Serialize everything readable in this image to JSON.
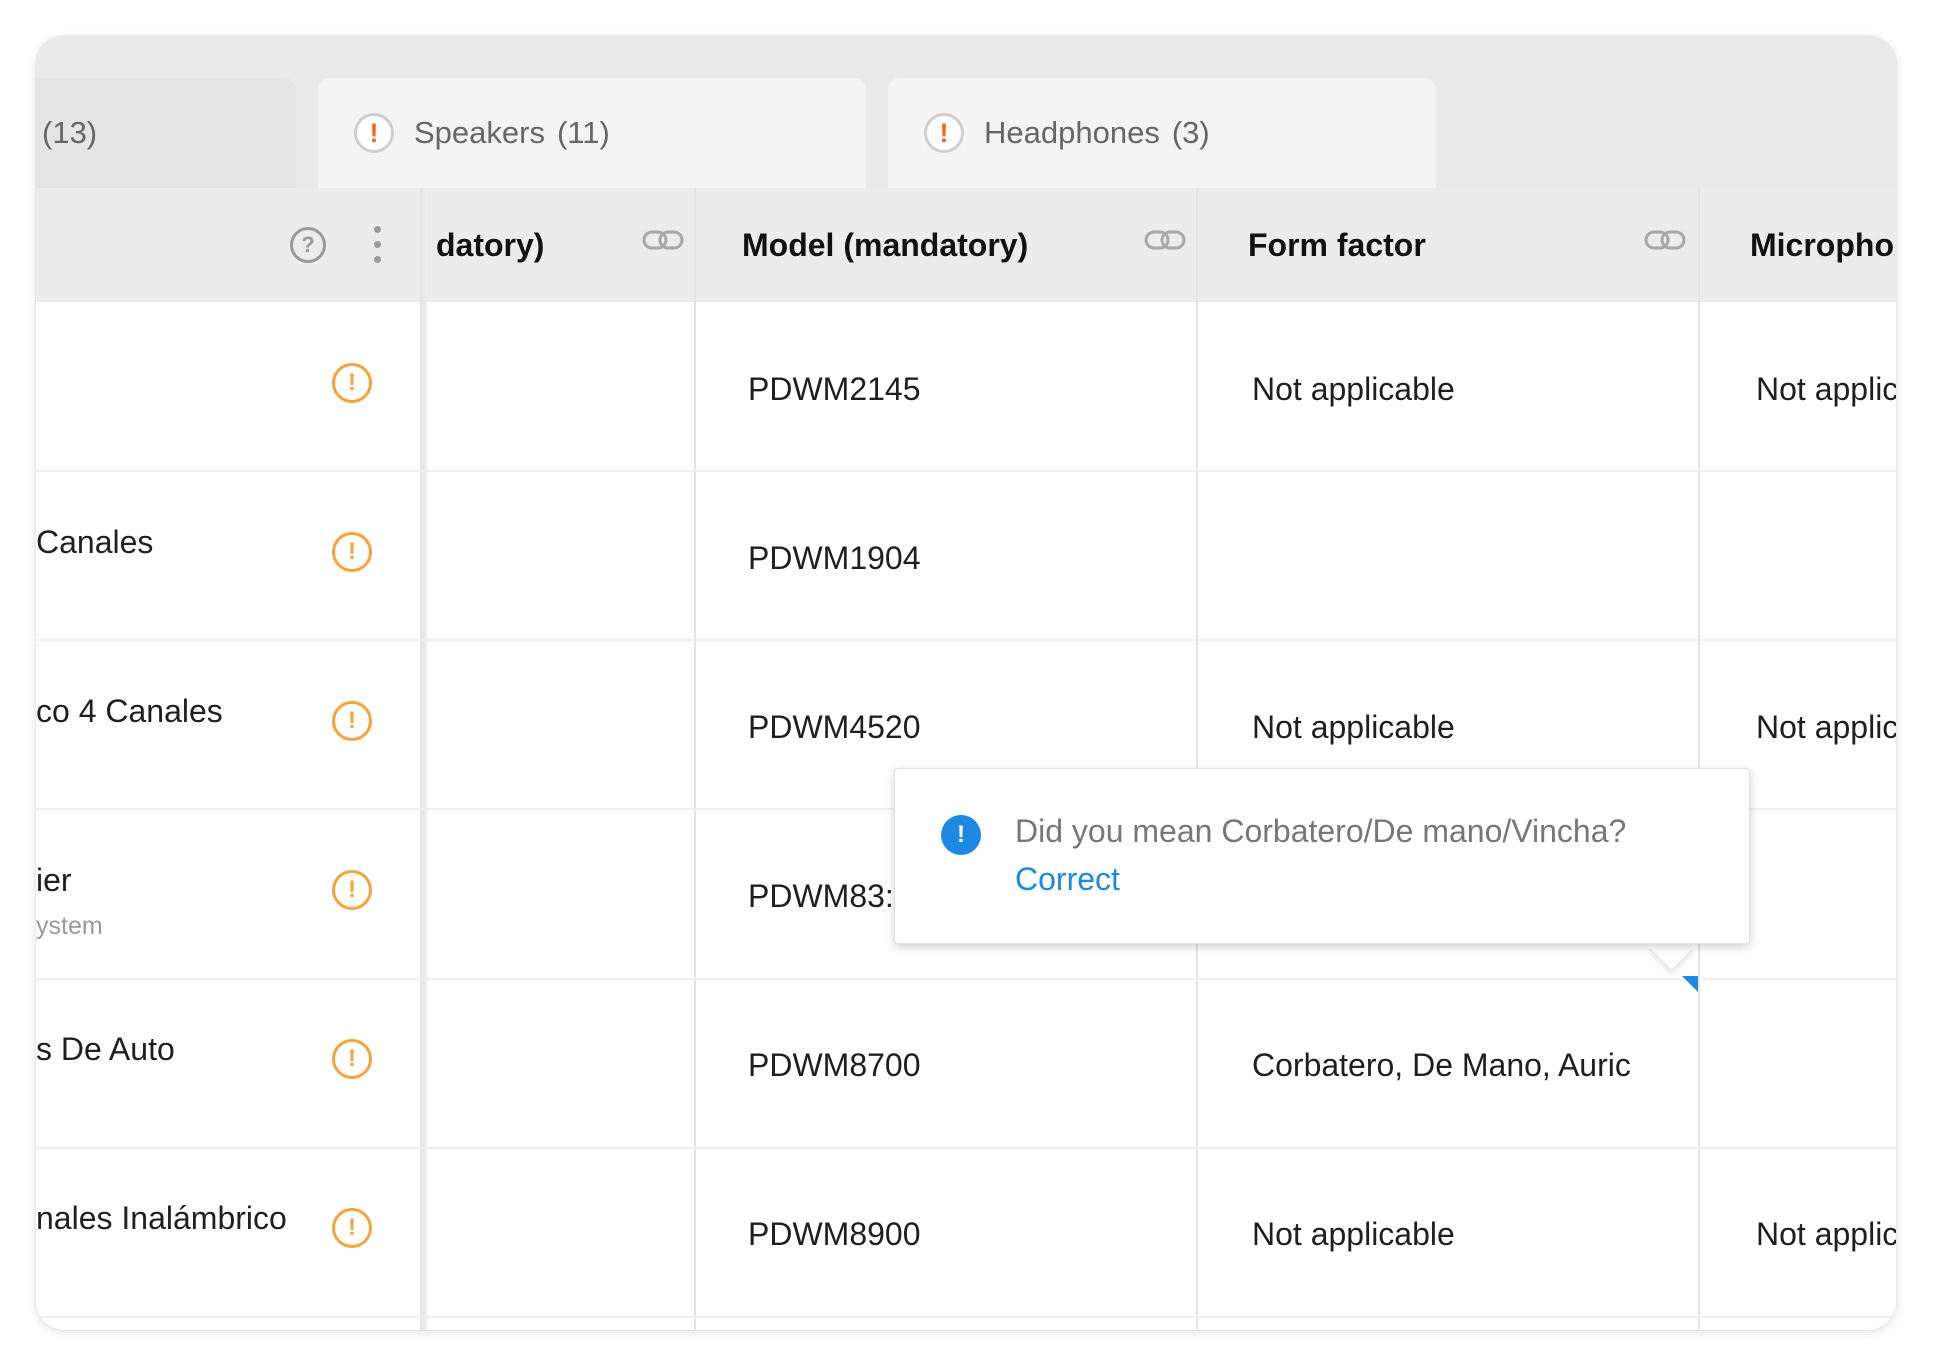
{
  "tabs": [
    {
      "label": "",
      "count": "(13)"
    },
    {
      "label": "Speakers",
      "count": "(11)"
    },
    {
      "label": "Headphones",
      "count": "(3)"
    }
  ],
  "columns": {
    "first": "",
    "brand": "datory)",
    "model": "Model (mandatory)",
    "form_factor": "Form factor",
    "microphone": "Micropho"
  },
  "rows": [
    {
      "name": "",
      "sub": "",
      "model": "PDWM2145",
      "form_factor": "Not applicable",
      "microphone": "Not applic"
    },
    {
      "name": "Canales",
      "sub": "",
      "model": "PDWM1904",
      "form_factor": "",
      "microphone": ""
    },
    {
      "name": "co 4 Canales",
      "sub": "",
      "model": "PDWM4520",
      "form_factor": "Not applicable",
      "microphone": "Not applic"
    },
    {
      "name": "ier",
      "sub": "ystem",
      "model": "PDWM83:",
      "form_factor": "",
      "microphone": ""
    },
    {
      "name": "s De Auto",
      "sub": "",
      "model": "PDWM8700",
      "form_factor": "Corbatero, De Mano, Auric",
      "microphone": ""
    },
    {
      "name": "nales Inalámbrico",
      "sub": "",
      "model": "PDWM8900",
      "form_factor": "Not applicable",
      "microphone": "Not applic"
    }
  ],
  "popover": {
    "message": "Did you mean Corbatero/De mano/Vincha?",
    "action": "Correct"
  },
  "colors": {
    "warning_orange": "#f5a33b",
    "tab_warning": "#f26b1d",
    "info_blue": "#1e88e5",
    "header_bg": "#ececec"
  },
  "icons": {
    "tab_status": "exclamation-circle-icon",
    "row_status": "warning-circle-icon",
    "header_link": "link-icon",
    "help": "question-circle-icon",
    "menu": "kebab-menu-icon",
    "info": "info-icon"
  }
}
